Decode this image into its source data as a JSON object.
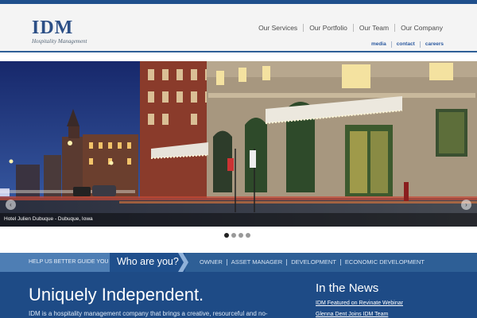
{
  "logo": {
    "mark": "IDM",
    "sub": "Hospitality Management"
  },
  "nav": {
    "items": [
      "Our Services",
      "Our Portfolio",
      "Our Team",
      "Our Company"
    ]
  },
  "subnav": {
    "items": [
      "media",
      "contact",
      "careers"
    ]
  },
  "hero": {
    "caption": "Hotel Julien Dubuque - Dubuque, Iowa",
    "prev": "‹",
    "next": "›",
    "slide_count": 4,
    "active_slide": 1
  },
  "guide": {
    "prompt": "HELP US BETTER GUIDE YOU",
    "question": "Who are you?",
    "links": [
      "OWNER",
      "ASSET MANAGER",
      "DEVELOPMENT",
      "ECONOMIC DEVELOPMENT"
    ]
  },
  "main": {
    "tagline": "Uniquely Independent.",
    "intro": "IDM is a hospitality management company that brings a creative, resourceful and no-"
  },
  "news": {
    "title": "In the News",
    "items": [
      "IDM Featured on Revinate Webinar",
      "Glenna Dent Joins IDM Team"
    ]
  },
  "colors": {
    "brand": "#1f4f8c",
    "accent": "#2c5aa0",
    "banner": "#2e5f96"
  }
}
